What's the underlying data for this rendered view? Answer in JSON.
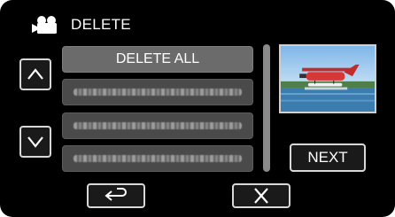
{
  "header": {
    "title": "DELETE",
    "icon": "video-camera-icon"
  },
  "list": {
    "delete_all_label": "DELETE ALL",
    "file_items": [
      "",
      "",
      ""
    ]
  },
  "nav": {
    "up_icon": "chevron-up-icon",
    "down_icon": "chevron-down-icon"
  },
  "preview": {
    "icon": "seaplane-thumbnail"
  },
  "buttons": {
    "next_label": "NEXT",
    "back_icon": "return-arrow-icon",
    "close_icon": "close-icon"
  },
  "colors": {
    "screen_bg": "#000000",
    "button_border": "#d8d8d8",
    "primary_item": "#6b6b6b",
    "file_item": "#4a4a4a"
  }
}
